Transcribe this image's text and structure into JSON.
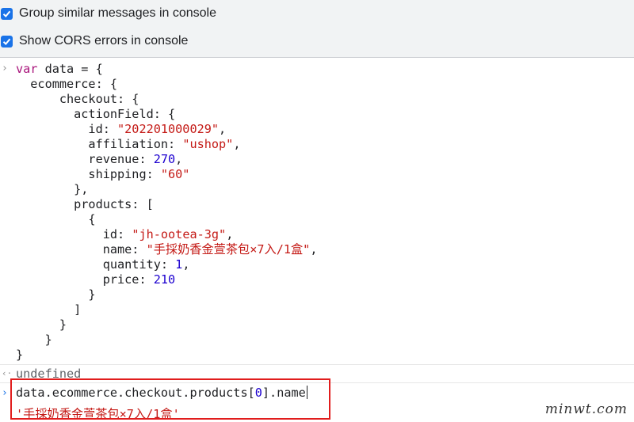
{
  "settings": {
    "group_similar_label": "Group similar messages in console",
    "group_similar_checked": true,
    "show_cors_label": "Show CORS errors in console",
    "show_cors_checked": true
  },
  "console": {
    "code": {
      "l1_kw": "var",
      "l1_rest": " data = {",
      "l2": "  ecommerce: {",
      "l3": "      checkout: {",
      "l4": "        actionField: {",
      "l5_key": "          id: ",
      "l5_val": "\"202201000029\"",
      "l5_end": ",",
      "l6_key": "          affiliation: ",
      "l6_val": "\"ushop\"",
      "l6_end": ",",
      "l7_key": "          revenue: ",
      "l7_val": "270",
      "l7_end": ",",
      "l8_key": "          shipping: ",
      "l8_val": "\"60\"",
      "l9": "        },",
      "l10": "        products: [",
      "l11": "          {",
      "l12_key": "            id: ",
      "l12_val": "\"jh-ootea-3g\"",
      "l12_end": ",",
      "l13_key": "            name: ",
      "l13_val": "\"手採奶香金萱茶包×7入/1盒\"",
      "l13_end": ",",
      "l14_key": "            quantity: ",
      "l14_val": "1",
      "l14_end": ",",
      "l15_key": "            price: ",
      "l15_val": "210",
      "l16": "          }",
      "l17": "        ]",
      "l18": "      }",
      "l19": "    }",
      "l20": "}"
    },
    "result_undefined": "undefined",
    "input_expression_pre": "data.ecommerce.checkout.products[",
    "input_expression_index": "0",
    "input_expression_post": "].name",
    "output_value": "'手採奶香金萱茶包×7入/1盒'",
    "prompt_glyph": "›",
    "return_glyph": "‹·"
  },
  "watermark": "minwt.com",
  "colors": {
    "checkbox": "#1a73e8",
    "keyword": "#a8127a",
    "string": "#c41a16",
    "number": "#1c00cf",
    "highlight_box": "#e11d1d"
  }
}
